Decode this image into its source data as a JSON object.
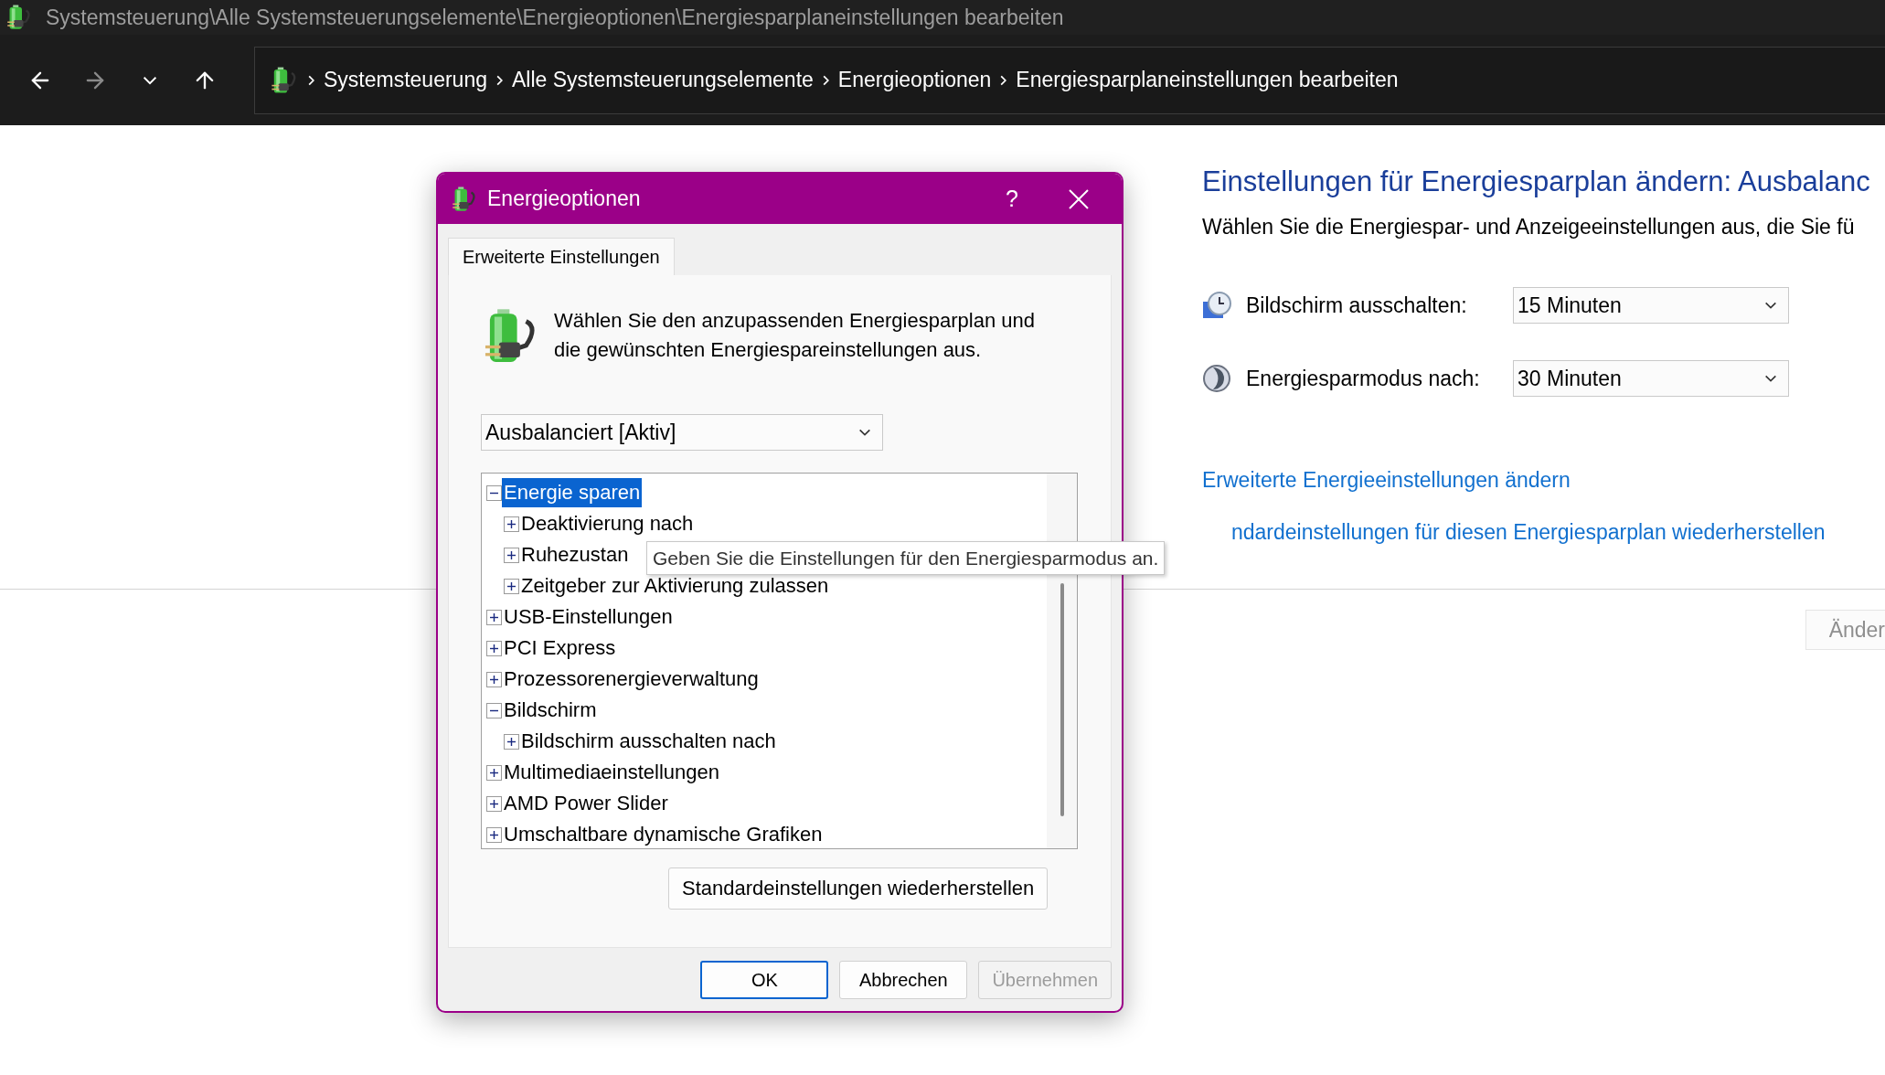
{
  "window": {
    "title": "Systemsteuerung\\Alle Systemsteuerungselemente\\Energieoptionen\\Energiesparplaneinstellungen bearbeiten"
  },
  "nav": {
    "buttons": [
      {
        "kind": "back",
        "disabled": false
      },
      {
        "kind": "forward",
        "disabled": true
      },
      {
        "kind": "history",
        "disabled": false
      },
      {
        "kind": "up",
        "disabled": false
      }
    ],
    "breadcrumb": [
      "Systemsteuerung",
      "Alle Systemsteuerungselemente",
      "Energieoptionen",
      "Energiesparplaneinstellungen bearbeiten"
    ]
  },
  "page": {
    "heading": "Einstellungen für Energiesparplan ändern: Ausbalanc",
    "description": "Wählen Sie die Energiespar- und Anzeigeeinstellungen aus, die Sie fü",
    "settings": [
      {
        "kind": "display",
        "label": "Bildschirm ausschalten:",
        "value": "15 Minuten"
      },
      {
        "kind": "sleep",
        "label": "Energiesparmodus nach:",
        "value": "30 Minuten"
      }
    ],
    "links": [
      "Erweiterte Energieeinstellungen ändern",
      "ndardeinstellungen für diesen Energiesparplan wiederherstellen"
    ],
    "button": {
      "label": "Änder",
      "disabled": true
    }
  },
  "dialog": {
    "title": "Energieoptionen",
    "help": "?",
    "tabs": [
      {
        "label": "Erweiterte Einstellungen",
        "selected": true
      }
    ],
    "intro": "Wählen Sie den anzupassenden Energiesparplan und die gewünschten Energiespareinstellungen aus.",
    "plan": "Ausbalanciert [Aktiv]",
    "tree": [
      {
        "label": "Energie sparen",
        "expanded": true,
        "selected": true,
        "children": [
          {
            "label": "Deaktivierung nach",
            "expanded": false,
            "selected": false
          },
          {
            "label": "Ruhezustan",
            "expanded": false,
            "selected": false
          },
          {
            "label": "Zeitgeber zur Aktivierung zulassen",
            "expanded": false,
            "selected": false
          }
        ]
      },
      {
        "label": "USB-Einstellungen",
        "expanded": false,
        "selected": false
      },
      {
        "label": "PCI Express",
        "expanded": false,
        "selected": false
      },
      {
        "label": "Prozessorenergieverwaltung",
        "expanded": false,
        "selected": false
      },
      {
        "label": "Bildschirm",
        "expanded": true,
        "selected": false,
        "children": [
          {
            "label": "Bildschirm ausschalten nach",
            "expanded": false,
            "selected": false
          }
        ]
      },
      {
        "label": "Multimediaeinstellungen",
        "expanded": false,
        "selected": false
      },
      {
        "label": "AMD Power Slider",
        "expanded": false,
        "selected": false
      },
      {
        "label": "Umschaltbare dynamische Grafiken",
        "expanded": false,
        "selected": false
      }
    ],
    "tooltip": "Geben Sie die Einstellungen für den Energiesparmodus an.",
    "restore_button": "Standardeinstellungen wiederherstellen",
    "buttons": [
      {
        "label": "OK",
        "default": true,
        "disabled": false
      },
      {
        "label": "Abbrechen",
        "default": false,
        "disabled": false
      },
      {
        "label": "Übernehmen",
        "default": false,
        "disabled": true
      }
    ]
  }
}
